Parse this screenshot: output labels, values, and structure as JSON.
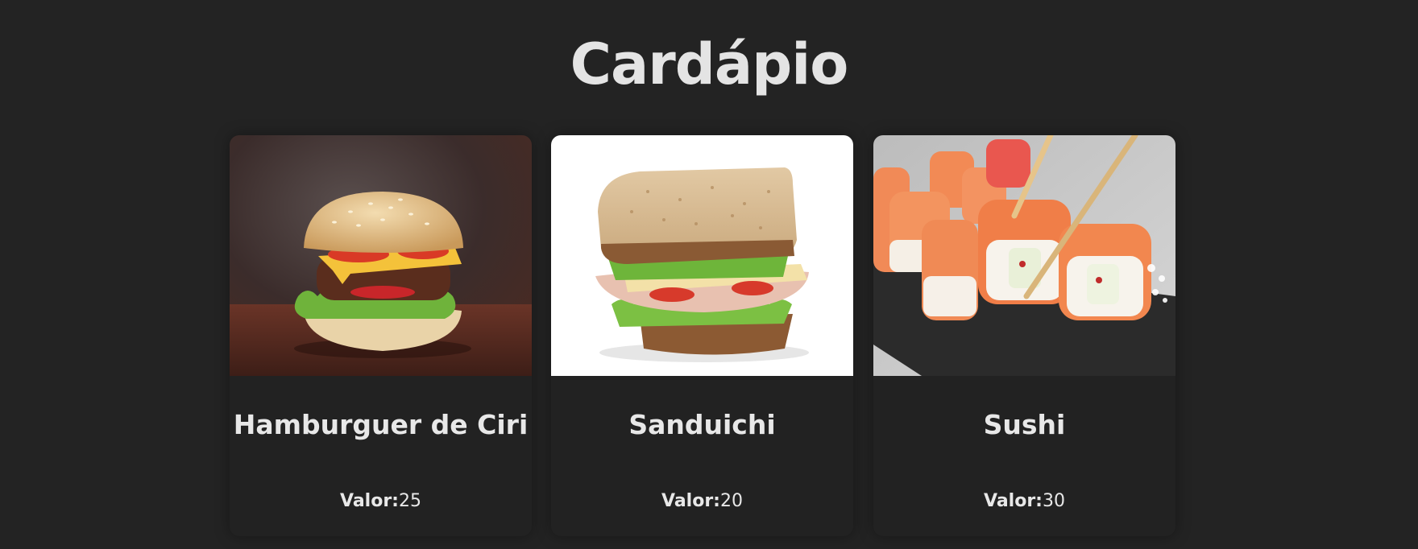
{
  "page": {
    "title": "Cardápio"
  },
  "menu": {
    "items": [
      {
        "name": "Hamburguer de Ciri",
        "price_label": "Valor:",
        "price": "25",
        "image_icon": "burger-photo"
      },
      {
        "name": "Sanduichi",
        "price_label": "Valor:",
        "price": "20",
        "image_icon": "sandwich-photo"
      },
      {
        "name": "Sushi",
        "price_label": "Valor:",
        "price": "30",
        "image_icon": "sushi-photo"
      }
    ]
  },
  "colors": {
    "background": "#232323",
    "card": "#222222",
    "text": "#e6e6e6"
  }
}
